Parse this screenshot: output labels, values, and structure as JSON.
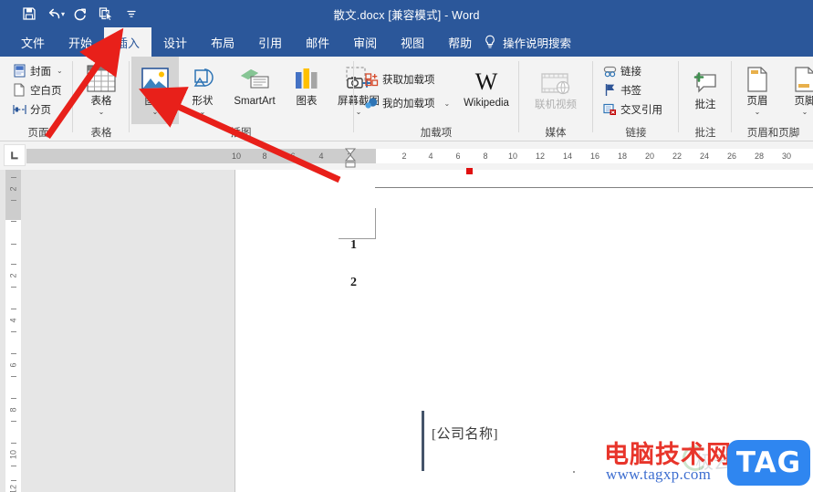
{
  "titlebar": {
    "document_title": "散文.docx [兼容模式]  -  Word",
    "quick_access": [
      {
        "name": "save-icon",
        "label": "保存"
      },
      {
        "name": "undo-icon",
        "label": "撤销"
      },
      {
        "name": "redo-icon",
        "label": "恢复"
      },
      {
        "name": "format-painter-icon",
        "label": "格式刷"
      },
      {
        "name": "customize-qat-icon",
        "label": "自定义快速访问工具栏"
      }
    ]
  },
  "tabs": [
    {
      "label": "文件",
      "active": false
    },
    {
      "label": "开始",
      "active": false
    },
    {
      "label": "插入",
      "active": true
    },
    {
      "label": "设计",
      "active": false
    },
    {
      "label": "布局",
      "active": false
    },
    {
      "label": "引用",
      "active": false
    },
    {
      "label": "邮件",
      "active": false
    },
    {
      "label": "审阅",
      "active": false
    },
    {
      "label": "视图",
      "active": false
    },
    {
      "label": "帮助",
      "active": false
    }
  ],
  "tell_me": {
    "label": "操作说明搜索",
    "icon": "lightbulb-icon"
  },
  "ribbon": {
    "groups": [
      {
        "label": "页面",
        "items": [
          {
            "label": "封面",
            "icon": "cover-page-icon",
            "dropdown": true
          },
          {
            "label": "空白页",
            "icon": "blank-page-icon",
            "dropdown": false
          },
          {
            "label": "分页",
            "icon": "page-break-icon",
            "dropdown": false
          }
        ]
      },
      {
        "label": "表格",
        "items": [
          {
            "label": "表格",
            "icon": "table-icon",
            "dropdown": true
          }
        ]
      },
      {
        "label": "插图",
        "items": [
          {
            "label": "图片",
            "icon": "pictures-icon",
            "dropdown": true,
            "selected": true
          },
          {
            "label": "形状",
            "icon": "shapes-icon",
            "dropdown": true
          },
          {
            "label": "SmartArt",
            "icon": "smartart-icon",
            "dropdown": false
          },
          {
            "label": "图表",
            "icon": "chart-icon",
            "dropdown": false
          },
          {
            "label": "屏幕截图",
            "icon": "screenshot-icon",
            "dropdown": true
          }
        ]
      },
      {
        "label": "加载项",
        "items": [
          {
            "label": "获取加载项",
            "icon": "get-addins-icon",
            "dropdown": false
          },
          {
            "label": "我的加载项",
            "icon": "my-addins-icon",
            "dropdown": true
          },
          {
            "label": "Wikipedia",
            "icon": "wikipedia-icon",
            "dropdown": false
          }
        ]
      },
      {
        "label": "媒体",
        "items": [
          {
            "label": "联机视频",
            "icon": "online-video-icon",
            "disabled": true
          }
        ]
      },
      {
        "label": "链接",
        "items": [
          {
            "label": "链接",
            "icon": "link-icon",
            "dropdown": false
          },
          {
            "label": "书签",
            "icon": "bookmark-icon",
            "dropdown": false
          },
          {
            "label": "交叉引用",
            "icon": "cross-reference-icon",
            "dropdown": false
          }
        ]
      },
      {
        "label": "批注",
        "items": [
          {
            "label": "批注",
            "icon": "new-comment-icon",
            "dropdown": false
          }
        ]
      },
      {
        "label": "页眉和页脚",
        "items": [
          {
            "label": "页眉",
            "icon": "header-icon",
            "dropdown": true
          },
          {
            "label": "页脚",
            "icon": "footer-icon",
            "dropdown": true
          }
        ]
      }
    ]
  },
  "ruler": {
    "tab_selector": "left-tab-stop",
    "horizontal_left_numbers": [
      "10",
      "8",
      "6",
      "4",
      "2"
    ],
    "horizontal_right_numbers": [
      "2",
      "4",
      "6",
      "8",
      "10",
      "12",
      "14",
      "16",
      "18",
      "20",
      "22",
      "24",
      "26",
      "28",
      "30"
    ],
    "vertical_numbers": [
      "2",
      "2",
      "4",
      "6",
      "8",
      "10",
      "12"
    ]
  },
  "document": {
    "list_items": [
      "1",
      "2"
    ],
    "company_placeholder": "[公司名称]"
  },
  "watermark": {
    "site_name": "电脑技术网",
    "url": "www.tagxp.com",
    "badge": "TAG",
    "ghost_text": "极云下载站"
  },
  "annotations": {
    "arrow1": "points to 表格/图片 area of 插图 group",
    "arrow2": "points to 图片 button"
  },
  "colors": {
    "word_blue": "#2b579a",
    "ribbon_bg": "#f3f3f3",
    "arrow_red": "#e8201a",
    "accent_badge": "#2f86f0"
  }
}
